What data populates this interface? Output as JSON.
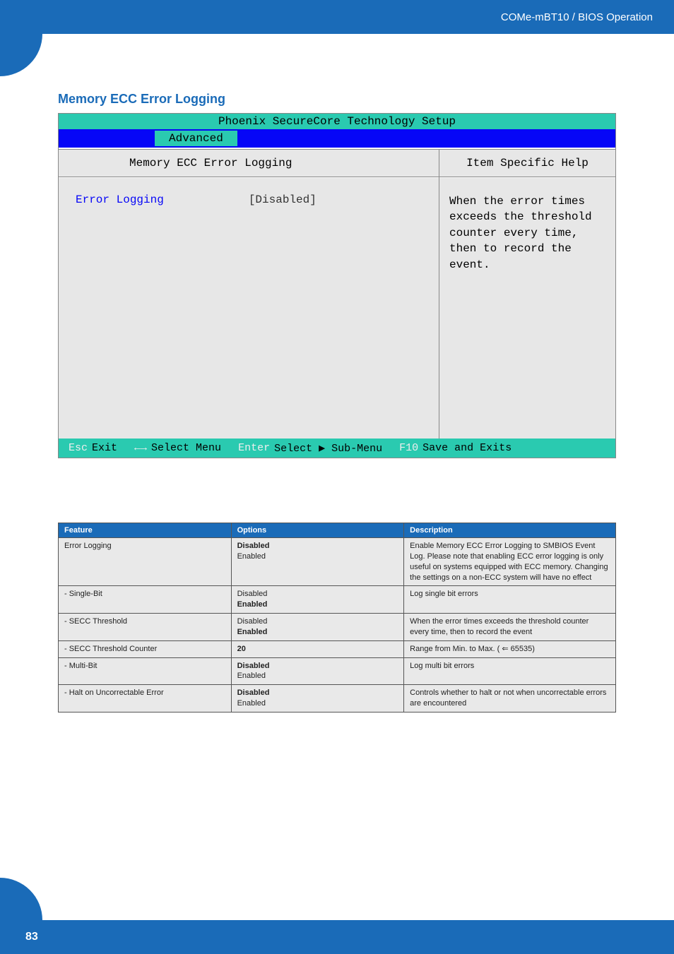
{
  "header": {
    "breadcrumb": "COMe-mBT10 / BIOS Operation"
  },
  "section": {
    "title": "Memory ECC Error Logging"
  },
  "bios": {
    "title": "Phoenix SecureCore Technology Setup",
    "active_tab": "Advanced",
    "left_header": "Memory ECC Error Logging",
    "right_header": "Item Specific Help",
    "setting_label": "Error Logging",
    "setting_value": "[Disabled]",
    "help_text": "When the error times exceeds the threshold counter every time, then to record the event.",
    "footer": {
      "esc_key": "Esc",
      "esc_label": "Exit",
      "arrows_key": "←→",
      "arrows_label": "Select Menu",
      "enter_key": "Enter",
      "enter_label": "Select ▶ Sub-Menu",
      "f10_key": "F10",
      "f10_label": "Save and Exits"
    }
  },
  "table": {
    "headers": {
      "feature": "Feature",
      "options": "Options",
      "description": "Description"
    },
    "rows": [
      {
        "feature": "Error Logging",
        "opt1": "Disabled",
        "opt1_bold": true,
        "opt2": "Enabled",
        "opt2_bold": false,
        "desc": "Enable Memory ECC Error Logging to SMBIOS Event Log. Please note that enabling ECC error logging is only useful on systems equipped with ECC memory. Changing the settings on a non-ECC system will have no effect"
      },
      {
        "feature": "- Single-Bit",
        "opt1": "Disabled",
        "opt1_bold": false,
        "opt2": "Enabled",
        "opt2_bold": true,
        "desc": "Log single bit errors"
      },
      {
        "feature": "- SECC Threshold",
        "opt1": "Disabled",
        "opt1_bold": false,
        "opt2": "Enabled",
        "opt2_bold": true,
        "desc": "When the error times exceeds the threshold counter every time, then to record the event"
      },
      {
        "feature": "- SECC Threshold Counter",
        "opt1": "20",
        "opt1_bold": true,
        "opt2": "",
        "opt2_bold": false,
        "desc": "Range from Min. to Max. ( ⇐ 65535)"
      },
      {
        "feature": "- Multi-Bit",
        "opt1": "Disabled",
        "opt1_bold": true,
        "opt2": "Enabled",
        "opt2_bold": false,
        "desc": "Log multi bit errors"
      },
      {
        "feature": "- Halt on Uncorrectable Error",
        "opt1": "Disabled",
        "opt1_bold": true,
        "opt2": "Enabled",
        "opt2_bold": false,
        "desc": "Controls whether to halt or not when uncorrectable errors are encountered"
      }
    ]
  },
  "footer": {
    "page_number": "83"
  }
}
